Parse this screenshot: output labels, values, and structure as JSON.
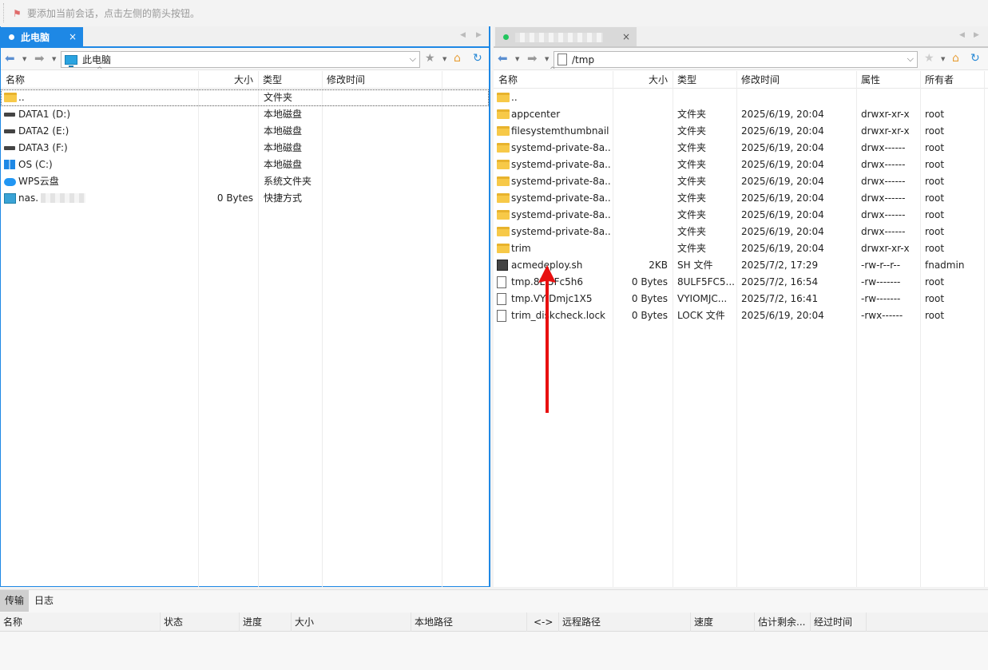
{
  "hint": "要添加当前会话，点击左侧的箭头按钮。",
  "left": {
    "tab_label": "此电脑",
    "path": "此电脑",
    "columns": [
      "名称",
      "大小",
      "类型",
      "修改时间"
    ],
    "rows": [
      {
        "name": "..",
        "size": "",
        "type": "文件夹",
        "icon": "folder-icon"
      },
      {
        "name": "DATA1 (D:)",
        "size": "",
        "type": "本地磁盘",
        "icon": "drive-icon"
      },
      {
        "name": "DATA2 (E:)",
        "size": "",
        "type": "本地磁盘",
        "icon": "drive-icon"
      },
      {
        "name": "DATA3 (F:)",
        "size": "",
        "type": "本地磁盘",
        "icon": "drive-icon"
      },
      {
        "name": "OS (C:)",
        "size": "",
        "type": "本地磁盘",
        "icon": "windows-drive-icon"
      },
      {
        "name": "WPS云盘",
        "size": "",
        "type": "系统文件夹",
        "icon": "cloud-icon"
      },
      {
        "name": "nas.",
        "size": "0 Bytes",
        "type": "快捷方式",
        "icon": "shortcut-icon"
      }
    ]
  },
  "right": {
    "tab_label": "",
    "path": "/tmp",
    "columns": [
      "名称",
      "大小",
      "类型",
      "修改时间",
      "属性",
      "所有者"
    ],
    "rows": [
      {
        "name": "..",
        "size": "",
        "type": "",
        "mtime": "",
        "attr": "",
        "owner": "",
        "icon": "folder-icon"
      },
      {
        "name": "appcenter",
        "size": "",
        "type": "文件夹",
        "mtime": "2025/6/19, 20:04",
        "attr": "drwxr-xr-x",
        "owner": "root",
        "icon": "folder-icon"
      },
      {
        "name": "filesystemthumbnail",
        "size": "",
        "type": "文件夹",
        "mtime": "2025/6/19, 20:04",
        "attr": "drwxr-xr-x",
        "owner": "root",
        "icon": "folder-icon"
      },
      {
        "name": "systemd-private-8a...",
        "size": "",
        "type": "文件夹",
        "mtime": "2025/6/19, 20:04",
        "attr": "drwx------",
        "owner": "root",
        "icon": "folder-icon"
      },
      {
        "name": "systemd-private-8a...",
        "size": "",
        "type": "文件夹",
        "mtime": "2025/6/19, 20:04",
        "attr": "drwx------",
        "owner": "root",
        "icon": "folder-icon"
      },
      {
        "name": "systemd-private-8a...",
        "size": "",
        "type": "文件夹",
        "mtime": "2025/6/19, 20:04",
        "attr": "drwx------",
        "owner": "root",
        "icon": "folder-icon"
      },
      {
        "name": "systemd-private-8a...",
        "size": "",
        "type": "文件夹",
        "mtime": "2025/6/19, 20:04",
        "attr": "drwx------",
        "owner": "root",
        "icon": "folder-icon"
      },
      {
        "name": "systemd-private-8a...",
        "size": "",
        "type": "文件夹",
        "mtime": "2025/6/19, 20:04",
        "attr": "drwx------",
        "owner": "root",
        "icon": "folder-icon"
      },
      {
        "name": "systemd-private-8a...",
        "size": "",
        "type": "文件夹",
        "mtime": "2025/6/19, 20:04",
        "attr": "drwx------",
        "owner": "root",
        "icon": "folder-icon"
      },
      {
        "name": "trim",
        "size": "",
        "type": "文件夹",
        "mtime": "2025/6/19, 20:04",
        "attr": "drwxr-xr-x",
        "owner": "root",
        "icon": "folder-icon"
      },
      {
        "name": "acmedeploy.sh",
        "size": "2KB",
        "type": "SH 文件",
        "mtime": "2025/7/2, 17:29",
        "attr": "-rw-r--r--",
        "owner": "fnadmin",
        "icon": "script-file-icon"
      },
      {
        "name": "tmp.8L 5Fc5h6",
        "size": "0 Bytes",
        "type": "8ULF5FC5...",
        "mtime": "2025/7/2, 16:54",
        "attr": "-rw-------",
        "owner": "root",
        "icon": "file-icon"
      },
      {
        "name": "tmp.VY Dmjc1X5",
        "size": "0 Bytes",
        "type": "VYIOMJC...",
        "mtime": "2025/7/2, 16:41",
        "attr": "-rw-------",
        "owner": "root",
        "icon": "file-icon"
      },
      {
        "name": "trim_diskcheck.lock",
        "size": "0 Bytes",
        "type": "LOCK 文件",
        "mtime": "2025/6/19, 20:04",
        "attr": "-rwx------",
        "owner": "root",
        "icon": "file-icon"
      }
    ]
  },
  "bottom": {
    "tabs": [
      "传输",
      "日志"
    ],
    "columns": [
      "名称",
      "状态",
      "进度",
      "大小",
      "本地路径",
      "<->",
      "远程路径",
      "速度",
      "估计剩余...",
      "经过时间"
    ]
  },
  "colors": {
    "accent": "#1e88e5",
    "arrow": "#e81010",
    "connected": "#22c55e"
  }
}
